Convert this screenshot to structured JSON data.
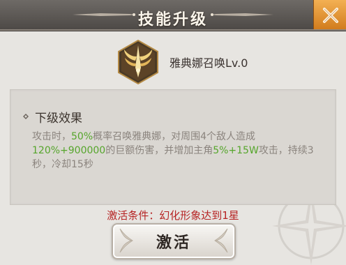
{
  "window": {
    "title": "技能升级"
  },
  "skill": {
    "name": "雅典娜召唤Lv.0"
  },
  "panel": {
    "section_title": "下级效果",
    "desc_parts": [
      {
        "text": "攻击时，",
        "highlight": false
      },
      {
        "text": "50%",
        "highlight": true
      },
      {
        "text": "概率召唤雅典娜，对周围4个敌人造成",
        "highlight": false
      },
      {
        "text": "120%+900000",
        "highlight": true
      },
      {
        "text": "的巨额伤害，并增加主角",
        "highlight": false
      },
      {
        "text": "5%+15W",
        "highlight": true
      },
      {
        "text": "攻击，持续3秒，冷却15秒",
        "highlight": false
      }
    ]
  },
  "activation": {
    "condition": "激活条件：幻化形象达到1星",
    "button_label": "激活"
  },
  "colors": {
    "highlight": "#55a52b",
    "condition": "#b62424",
    "close_button": "#e8952f"
  }
}
